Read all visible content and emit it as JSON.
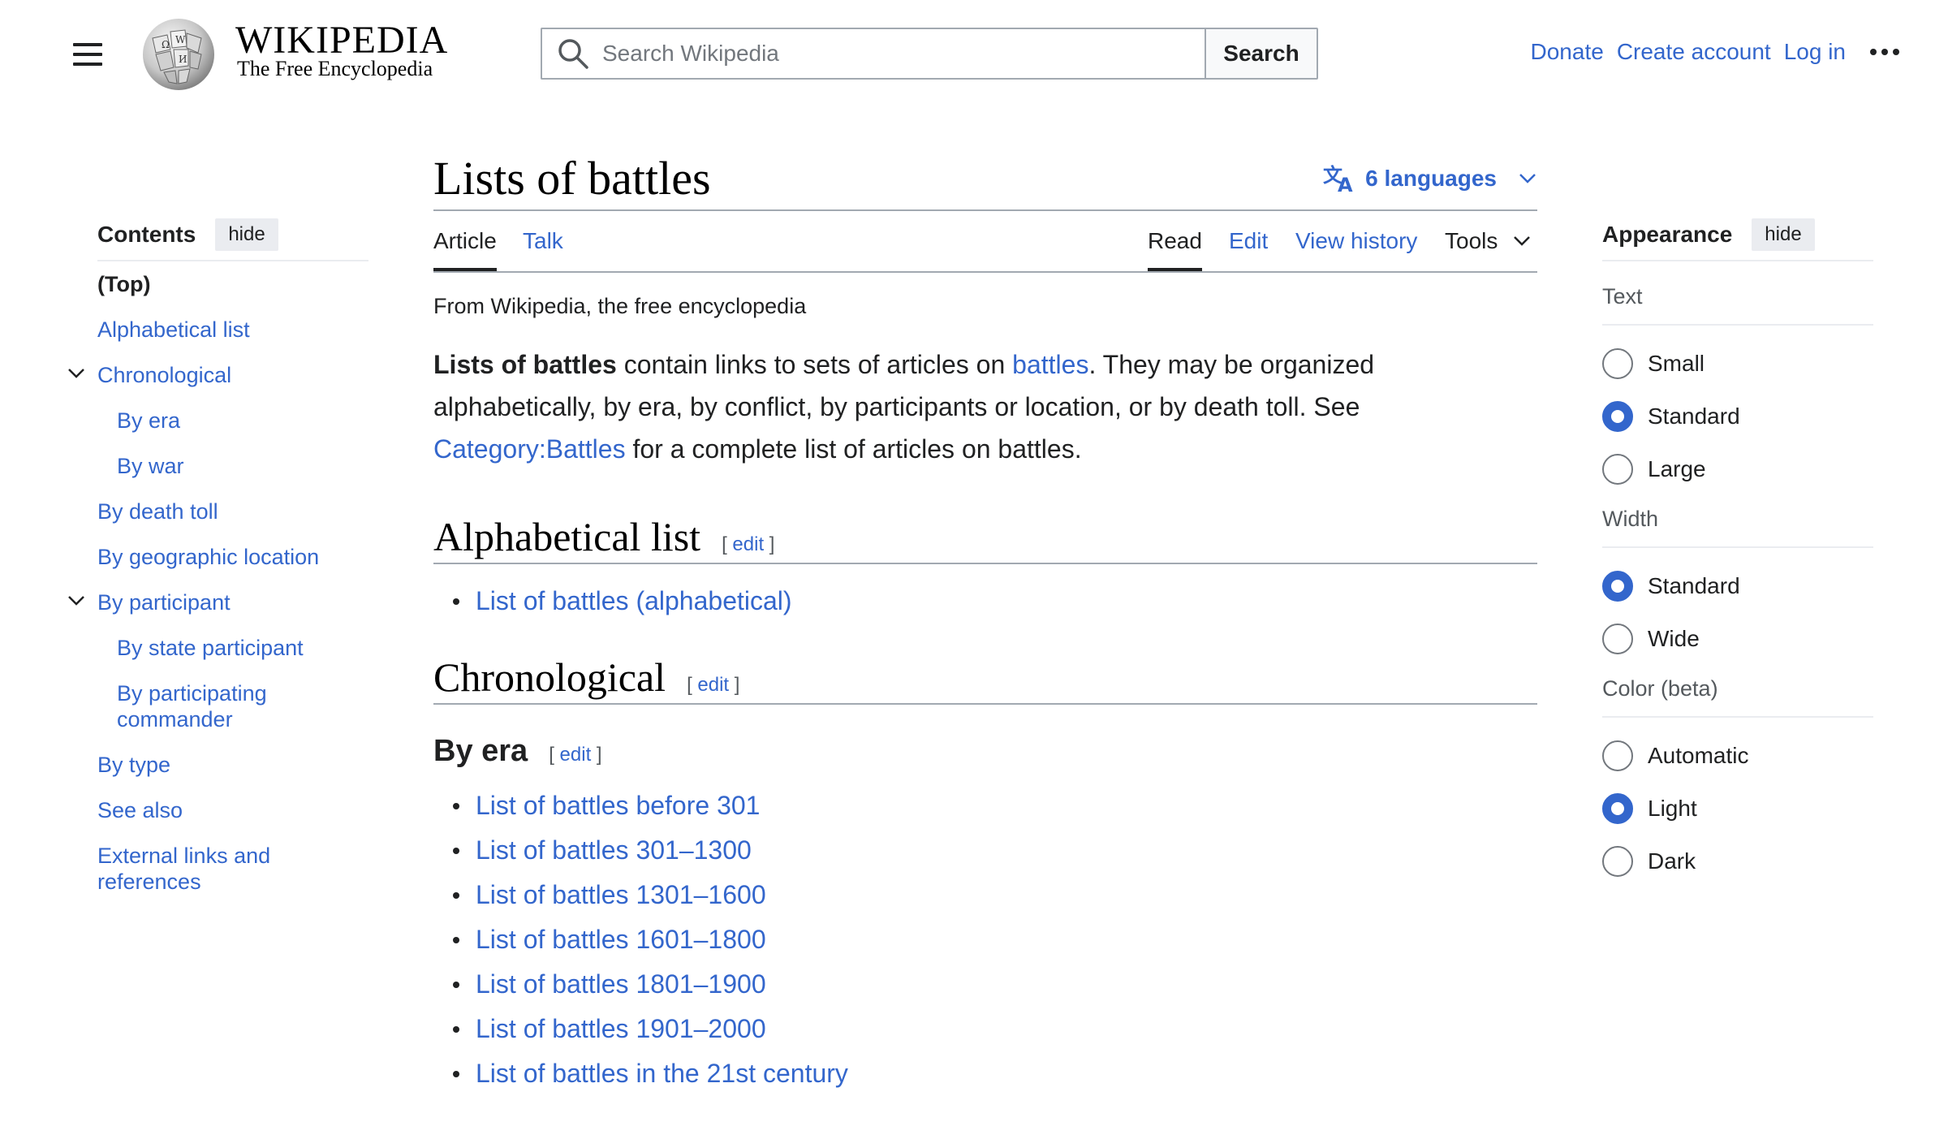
{
  "header": {
    "wordmark": "WIKIPEDIA",
    "tagline": "The Free Encyclopedia",
    "search_placeholder": "Search Wikipedia",
    "search_button": "Search",
    "links": [
      "Donate",
      "Create account",
      "Log in"
    ]
  },
  "toc": {
    "title": "Contents",
    "hide_label": "hide",
    "items": [
      {
        "label": "(Top)",
        "level": 0
      },
      {
        "label": "Alphabetical list",
        "level": 0
      },
      {
        "label": "Chronological",
        "level": 0
      },
      {
        "label": "By era",
        "level": 1
      },
      {
        "label": "By war",
        "level": 1
      },
      {
        "label": "By death toll",
        "level": 0
      },
      {
        "label": "By geographic location",
        "level": 0
      },
      {
        "label": "By participant",
        "level": 0
      },
      {
        "label": "By state participant",
        "level": 1
      },
      {
        "label": "By participating commander",
        "level": 1
      },
      {
        "label": "By type",
        "level": 0
      },
      {
        "label": "See also",
        "level": 0
      },
      {
        "label": "External links and references",
        "level": 0
      }
    ]
  },
  "article": {
    "title": "Lists of battles",
    "languages": "6 languages",
    "tabs": {
      "article": "Article",
      "talk": "Talk",
      "read": "Read",
      "edit": "Edit",
      "history": "View history",
      "tools": "Tools"
    },
    "from": "From Wikipedia, the free encyclopedia",
    "intro": {
      "bold": "Lists of battles",
      "t1": " contain links to sets of articles on ",
      "link1": "battles",
      "t2": ". They may be organized alphabetically, by era, by conflict, by participants or location, or by death toll. See ",
      "link2": "Category:Battles",
      "t3": " for a complete list of articles on battles."
    },
    "edit_open": "[",
    "edit_label": "edit",
    "edit_close": "]",
    "sections": {
      "alpha": {
        "heading": "Alphabetical list",
        "items": [
          "List of battles (alphabetical)"
        ]
      },
      "chrono": {
        "heading": "Chronological"
      },
      "era": {
        "heading": "By era",
        "items": [
          "List of battles before 301",
          "List of battles 301–1300",
          "List of battles 1301–1600",
          "List of battles 1601–1800",
          "List of battles 1801–1900",
          "List of battles 1901–2000",
          "List of battles in the 21st century"
        ]
      }
    }
  },
  "appearance": {
    "title": "Appearance",
    "hide_label": "hide",
    "text": {
      "label": "Text",
      "options": [
        "Small",
        "Standard",
        "Large"
      ],
      "selected": "Standard"
    },
    "width": {
      "label": "Width",
      "options": [
        "Standard",
        "Wide"
      ],
      "selected": "Standard"
    },
    "color": {
      "label": "Color (beta)",
      "options": [
        "Automatic",
        "Light",
        "Dark"
      ],
      "selected": "Light"
    }
  },
  "colors": {
    "link": "#3366cc",
    "text": "#202122",
    "border": "#a2a9b1"
  }
}
